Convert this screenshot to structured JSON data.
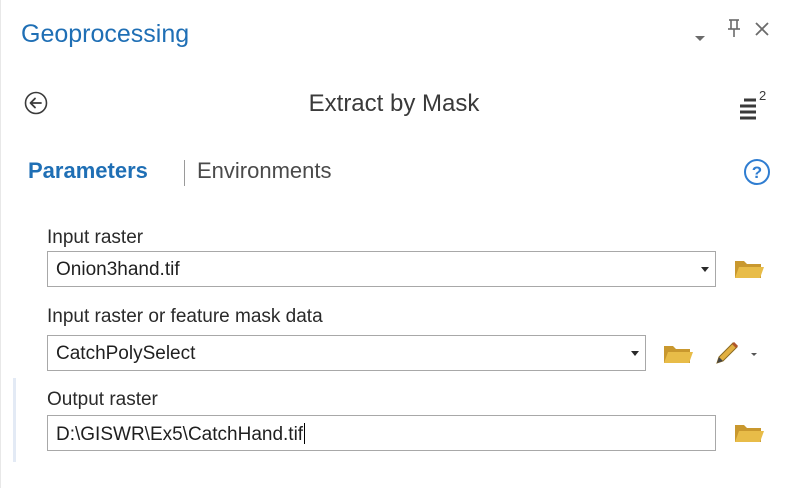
{
  "pane": {
    "title": "Geoprocessing",
    "controls": {
      "options_icon": "dropdown-arrow-icon",
      "pin_icon": "pin-icon",
      "pin_glyph": "٢",
      "close_icon": "close-icon",
      "close_glyph": "✕"
    }
  },
  "tool": {
    "title": "Extract by Mask",
    "back_icon": "back-arrow-icon",
    "menu_icon": "hamburger-menu-icon",
    "menu_badge": "2"
  },
  "tabs": {
    "parameters": "Parameters",
    "environments": "Environments",
    "help_icon": "help-icon"
  },
  "params": {
    "input_raster": {
      "label": "Input raster",
      "value": "Onion3hand.tif"
    },
    "mask_data": {
      "label": "Input raster or feature mask data",
      "value": "CatchPolySelect"
    },
    "output_raster": {
      "label": "Output raster",
      "value": "D:\\GISWR\\Ex5\\CatchHand.tif"
    }
  },
  "colors": {
    "accent": "#1f6fb5",
    "folder": "#e3b43c",
    "pencil": "#d9a63a"
  }
}
